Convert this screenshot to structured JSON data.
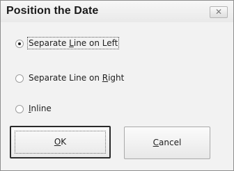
{
  "dialog": {
    "title": "Position the Date",
    "close_glyph": "✕"
  },
  "options": [
    {
      "label_pre": "Separate ",
      "label_key": "L",
      "label_post": "ine on Left",
      "selected": true
    },
    {
      "label_pre": "Separate Line on ",
      "label_key": "R",
      "label_post": "ight",
      "selected": false
    },
    {
      "label_pre": "",
      "label_key": "I",
      "label_post": "nline",
      "selected": false
    }
  ],
  "buttons": {
    "ok": {
      "label_key": "O",
      "label_post": "K"
    },
    "cancel": {
      "label_pre": "",
      "label_key": "C",
      "label_post": "ancel"
    }
  },
  "icons": {
    "close": "close-icon",
    "radio": "radio-icon"
  }
}
